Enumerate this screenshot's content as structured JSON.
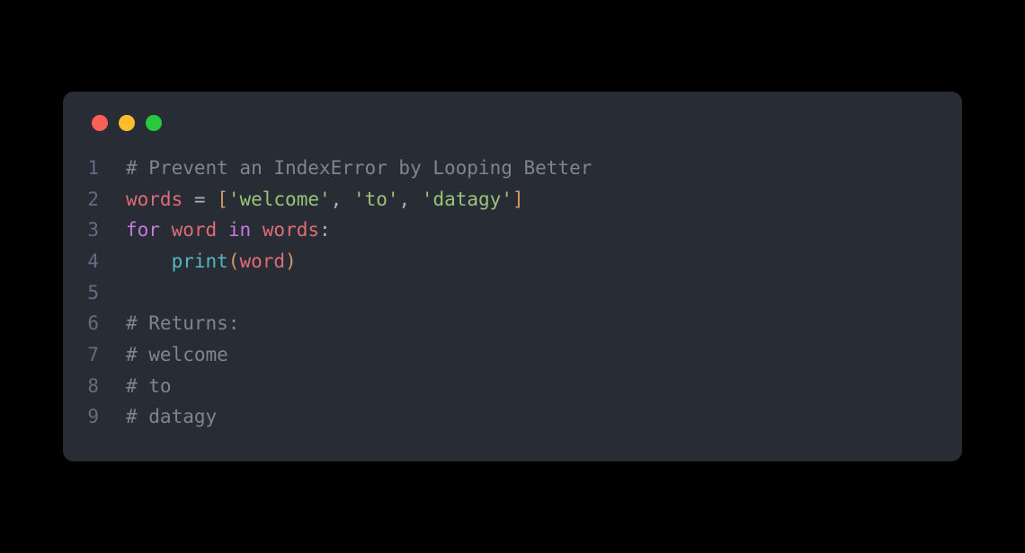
{
  "window": {
    "dots": [
      "red",
      "yellow",
      "green"
    ]
  },
  "code": {
    "lines": [
      {
        "num": "1",
        "tokens": [
          {
            "cls": "tk-comment",
            "text": "# Prevent an IndexError by Looping Better"
          }
        ]
      },
      {
        "num": "2",
        "tokens": [
          {
            "cls": "tk-identifier",
            "text": "words"
          },
          {
            "cls": "tk-plain",
            "text": " "
          },
          {
            "cls": "tk-operator",
            "text": "="
          },
          {
            "cls": "tk-plain",
            "text": " "
          },
          {
            "cls": "tk-bracket",
            "text": "["
          },
          {
            "cls": "tk-string",
            "text": "'welcome'"
          },
          {
            "cls": "tk-punct",
            "text": ", "
          },
          {
            "cls": "tk-string",
            "text": "'to'"
          },
          {
            "cls": "tk-punct",
            "text": ", "
          },
          {
            "cls": "tk-string",
            "text": "'datagy'"
          },
          {
            "cls": "tk-bracket",
            "text": "]"
          }
        ]
      },
      {
        "num": "3",
        "tokens": [
          {
            "cls": "tk-keyword",
            "text": "for"
          },
          {
            "cls": "tk-plain",
            "text": " "
          },
          {
            "cls": "tk-identifier",
            "text": "word"
          },
          {
            "cls": "tk-plain",
            "text": " "
          },
          {
            "cls": "tk-keyword",
            "text": "in"
          },
          {
            "cls": "tk-plain",
            "text": " "
          },
          {
            "cls": "tk-identifier",
            "text": "words"
          },
          {
            "cls": "tk-punct",
            "text": ":"
          }
        ]
      },
      {
        "num": "4",
        "tokens": [
          {
            "cls": "tk-plain",
            "text": "    "
          },
          {
            "cls": "tk-builtin",
            "text": "print"
          },
          {
            "cls": "tk-bracket",
            "text": "("
          },
          {
            "cls": "tk-identifier",
            "text": "word"
          },
          {
            "cls": "tk-bracket",
            "text": ")"
          }
        ]
      },
      {
        "num": "5",
        "tokens": []
      },
      {
        "num": "6",
        "tokens": [
          {
            "cls": "tk-comment",
            "text": "# Returns:"
          }
        ]
      },
      {
        "num": "7",
        "tokens": [
          {
            "cls": "tk-comment",
            "text": "# welcome"
          }
        ]
      },
      {
        "num": "8",
        "tokens": [
          {
            "cls": "tk-comment",
            "text": "# to"
          }
        ]
      },
      {
        "num": "9",
        "tokens": [
          {
            "cls": "tk-comment",
            "text": "# datagy"
          }
        ]
      }
    ]
  }
}
